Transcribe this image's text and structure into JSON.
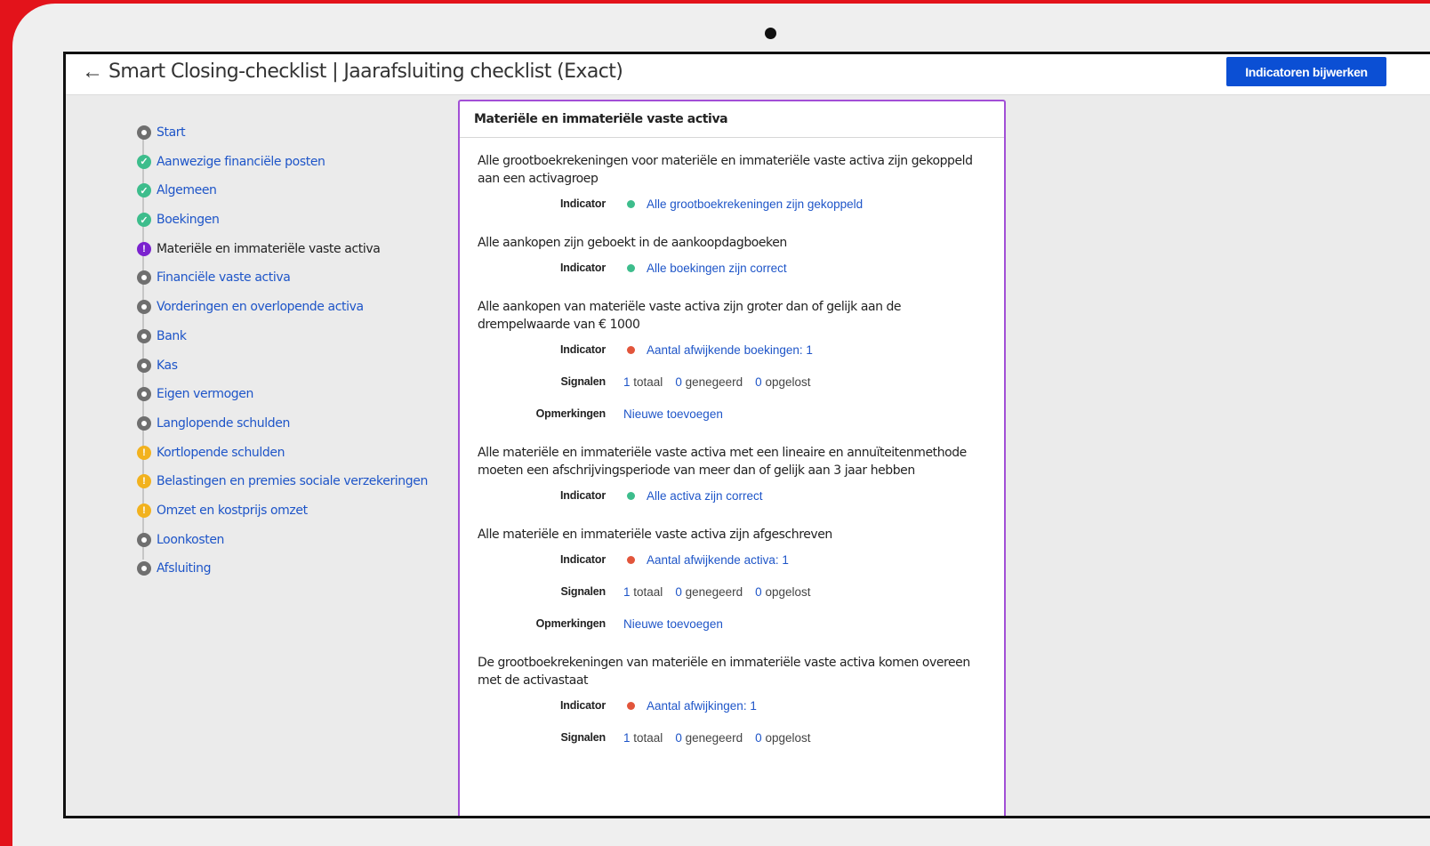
{
  "header": {
    "title": "Smart Closing-checklist | Jaarafsluiting checklist (Exact)",
    "update_button": "Indicatoren bijwerken"
  },
  "steps": [
    {
      "label": "Start",
      "status": "todo"
    },
    {
      "label": "Aanwezige financiële posten",
      "status": "done"
    },
    {
      "label": "Algemeen",
      "status": "done"
    },
    {
      "label": "Boekingen",
      "status": "done"
    },
    {
      "label": "Materiële en immateriële vaste activa",
      "status": "active"
    },
    {
      "label": "Financiële vaste activa",
      "status": "todo"
    },
    {
      "label": "Vorderingen en overlopende activa",
      "status": "todo"
    },
    {
      "label": "Bank",
      "status": "todo"
    },
    {
      "label": "Kas",
      "status": "todo"
    },
    {
      "label": "Eigen vermogen",
      "status": "todo"
    },
    {
      "label": "Langlopende schulden",
      "status": "todo"
    },
    {
      "label": "Kortlopende schulden",
      "status": "warning"
    },
    {
      "label": "Belastingen en premies sociale verzekeringen",
      "status": "warning"
    },
    {
      "label": "Omzet en kostprijs omzet",
      "status": "warning"
    },
    {
      "label": "Loonkosten",
      "status": "todo"
    },
    {
      "label": "Afsluiting",
      "status": "todo"
    }
  ],
  "panel": {
    "title": "Materiële en immateriële vaste activa",
    "labels": {
      "indicator": "Indicator",
      "signals": "Signalen",
      "remarks": "Opmerkingen",
      "total": "totaal",
      "ignored": "genegeerd",
      "resolved": "opgelost",
      "add_new": "Nieuwe toevoegen"
    },
    "checks": [
      {
        "text": "Alle grootboekrekeningen voor materiële en immateriële vaste activa zijn gekoppeld aan een activagroep",
        "indicator": {
          "status": "green",
          "text": "Alle grootboekrekeningen zijn gekoppeld"
        }
      },
      {
        "text": "Alle aankopen zijn geboekt in de aankoopdagboeken",
        "indicator": {
          "status": "green",
          "text": "Alle boekingen zijn correct"
        }
      },
      {
        "text": "Alle aankopen van materiële vaste activa zijn groter dan of gelijk aan de drempelwaarde van € 1000",
        "indicator": {
          "status": "red",
          "text": "Aantal afwijkende boekingen: 1"
        },
        "signals": {
          "total": 1,
          "ignored": 0,
          "resolved": 0
        },
        "remarks": true
      },
      {
        "text": "Alle materiële en immateriële vaste activa met een lineaire en annuïteitenmethode moeten een afschrijvingsperiode van meer dan of gelijk aan 3 jaar hebben",
        "indicator": {
          "status": "green",
          "text": "Alle activa zijn correct"
        }
      },
      {
        "text": "Alle materiële en immateriële vaste activa zijn afgeschreven",
        "indicator": {
          "status": "red",
          "text": "Aantal afwijkende activa: 1"
        },
        "signals": {
          "total": 1,
          "ignored": 0,
          "resolved": 0
        },
        "remarks": true
      },
      {
        "text": "De grootboekrekeningen van materiële en immateriële vaste activa komen overeen met de activastaat",
        "indicator": {
          "status": "red",
          "text": "Aantal afwijkingen: 1"
        },
        "signals": {
          "total": 1,
          "ignored": 0,
          "resolved": 0
        }
      }
    ]
  },
  "colors": {
    "brand_red": "#e3131b",
    "primary_blue": "#0b4fd4",
    "done_green": "#3dbd8c",
    "active_purple": "#7b22cf",
    "warning_yellow": "#f2b21e",
    "error_red": "#e2553b"
  }
}
